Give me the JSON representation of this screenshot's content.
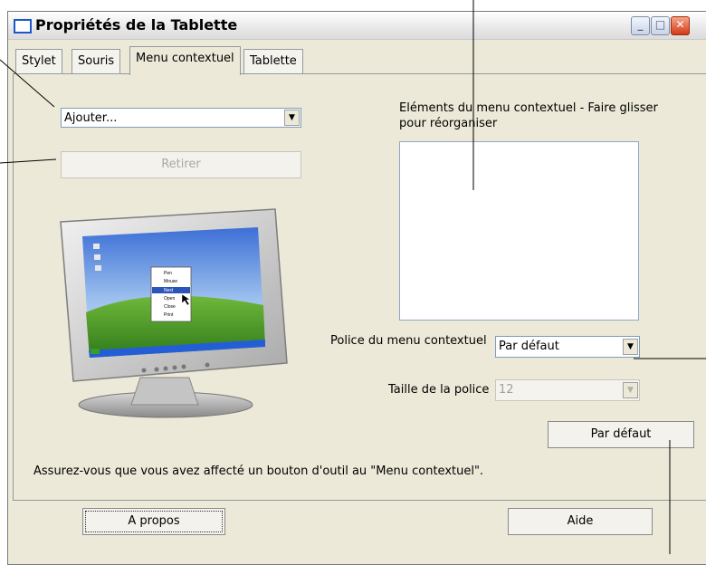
{
  "window": {
    "title": "Propriétés de la Tablette",
    "minimize_glyph": "_",
    "maximize_glyph": "□",
    "close_glyph": "✕"
  },
  "tabs": [
    {
      "label": "Stylet"
    },
    {
      "label": "Souris"
    },
    {
      "label": "Menu contextuel",
      "active": true
    },
    {
      "label": "Tablette"
    }
  ],
  "menu": {
    "add_combo_value": "Ajouter...",
    "remove_button_label": "Retirer",
    "elements_label": "Eléments du menu contextuel - Faire glisser pour réorganiser",
    "preview_menu_items": [
      "Pen",
      "Mouse",
      "Next",
      "Open",
      "Close",
      "Print"
    ],
    "font_label": "Police du menu contextuel",
    "font_value": "Par défaut",
    "size_label": "Taille de la police",
    "size_value": "12",
    "default_button_label": "Par défaut",
    "hint_text": "Assurez-vous que vous avez affecté un bouton d'outil au \"Menu contextuel\"."
  },
  "footer": {
    "about_label": "A propos",
    "help_label": "Aide"
  },
  "icons": {
    "combo_arrow": "chevron-down-icon",
    "title_icon": "window-icon"
  },
  "colors": {
    "dialog_background": "#ece9d8",
    "selected_menu_item": "#2b55b8",
    "close_button": "#d23b16"
  }
}
